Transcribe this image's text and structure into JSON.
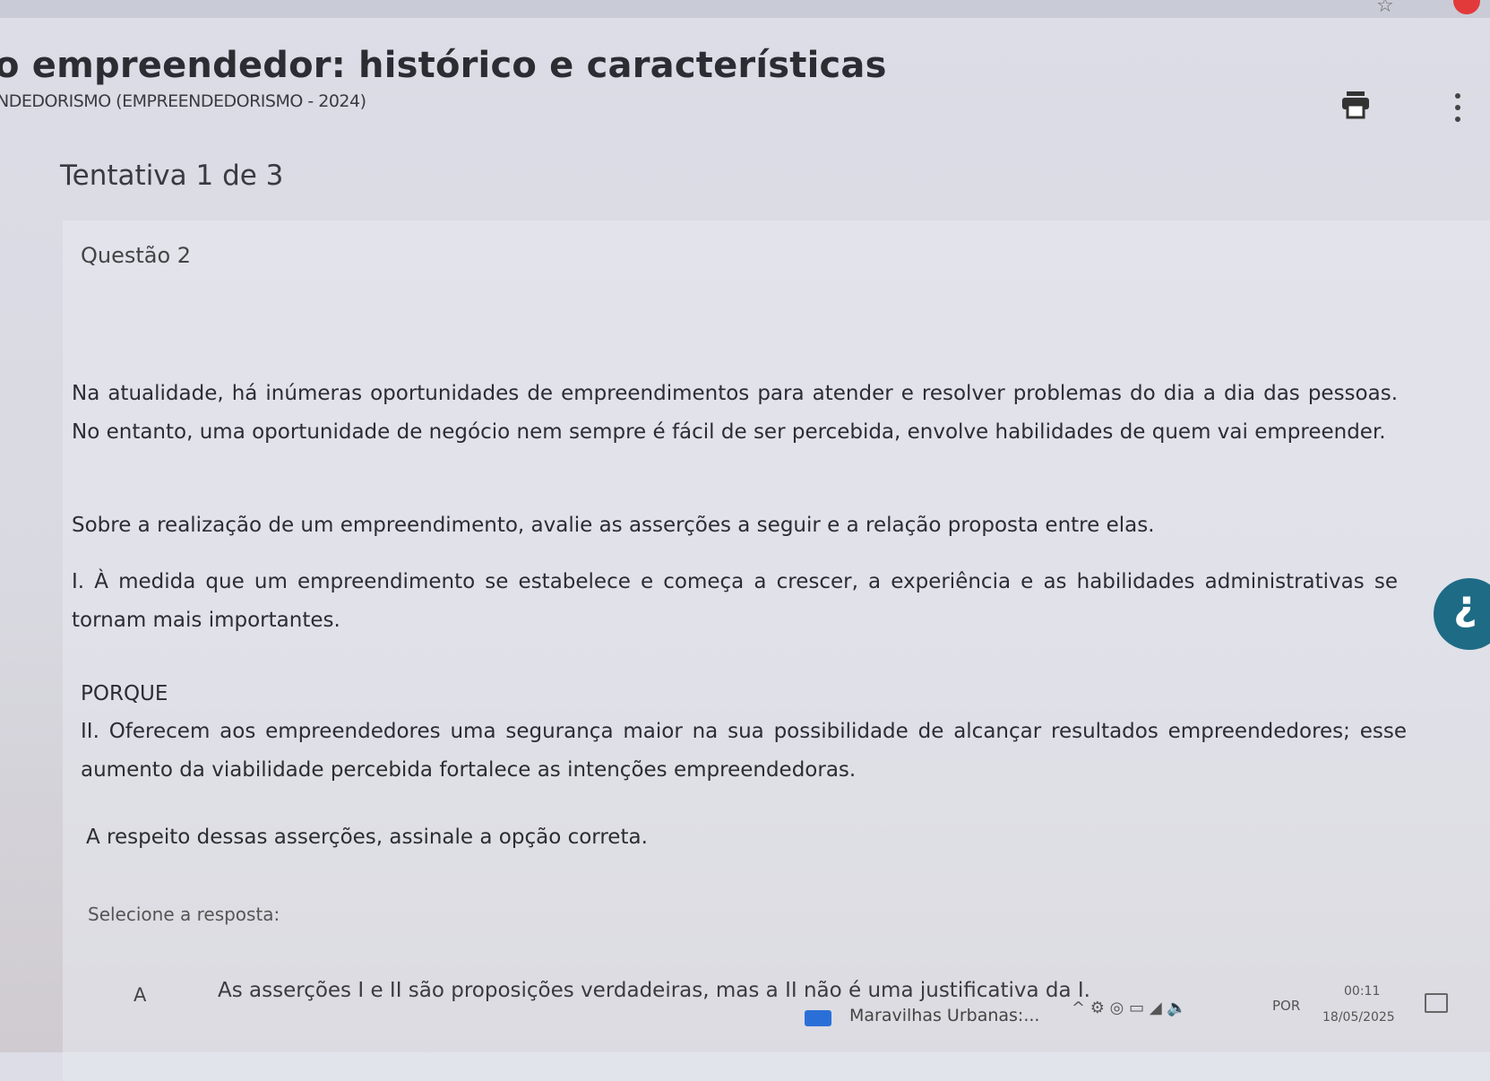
{
  "page": {
    "title": "o empreendedor: histórico e características",
    "subtitle": "NDEDORISMO (EMPREENDEDORISMO - 2024)",
    "attempt": "Tentativa 1 de 3"
  },
  "question": {
    "number": "Questão 2",
    "paragraph1": "Na atualidade, há inúmeras oportunidades de empreendimentos para atender e resolver problemas do dia a dia das pessoas. No entanto, uma oportunidade de negócio nem sempre é fácil de ser percebida, envolve habilidades de quem vai empreender.",
    "paragraph2": "Sobre a realização de um empreendimento, avalie as asserções a seguir e a relação proposta entre elas.",
    "assertion1": "I. À medida que um empreendimento se estabelece e começa a crescer, a experiência e as habilidades administrativas se tornam mais importantes.",
    "connector": "PORQUE",
    "assertion2": "II. Oferecem aos empreendedores uma segurança maior na sua possibilidade de alcançar resultados empreendedores; esse aumento da viabilidade percebida fortalece as intenções empreendedoras.",
    "prompt": "A respeito dessas asserções, assinale a opção correta.",
    "select_label": "Selecione a resposta:",
    "options": [
      {
        "letter": "A",
        "text": "As asserções I e II são proposições verdadeiras, mas a II não é uma justificativa da I."
      }
    ]
  },
  "taskbar": {
    "app_label": "Maravilhas Urbanas:...",
    "language": "POR",
    "time": "00:11",
    "date": "18/05/2025"
  },
  "colors": {
    "accent": "#1e6b86",
    "profile": "#e23a3a"
  },
  "icons": [
    "star-icon",
    "profile-icon",
    "print-icon",
    "more-icon",
    "accessibility-icon",
    "notification-icon"
  ]
}
